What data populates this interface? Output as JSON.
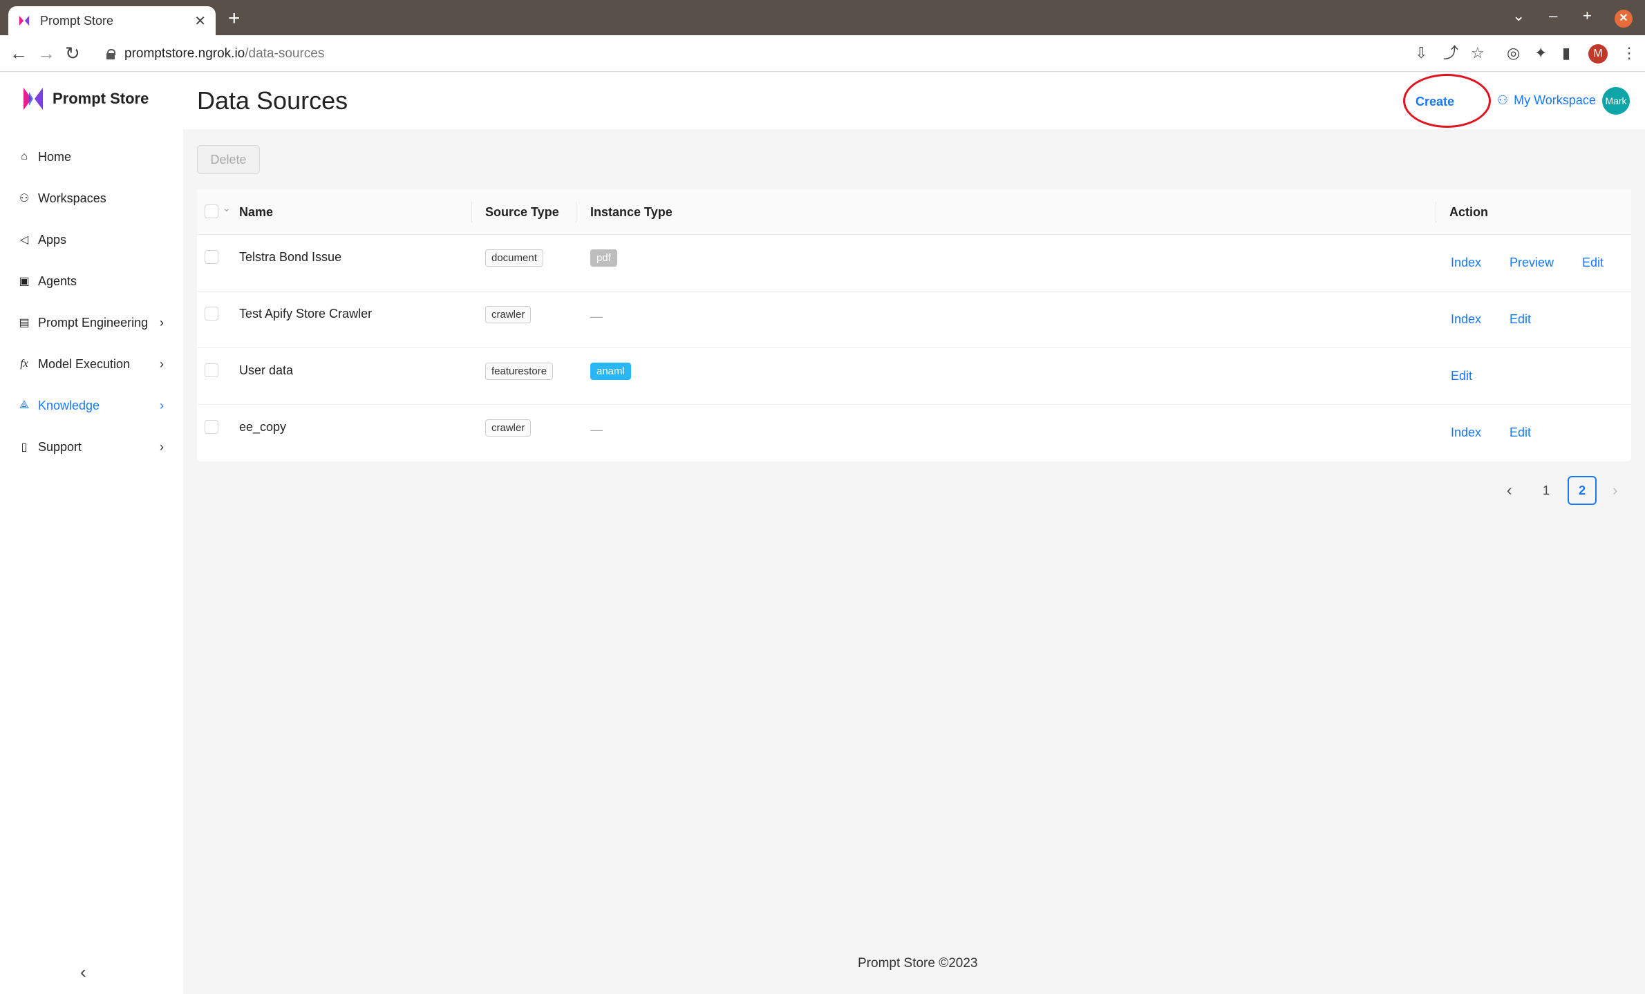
{
  "browser": {
    "tab_title": "Prompt Store",
    "url_host": "promptstore.ngrok.io",
    "url_path": "/data-sources",
    "profile_initial": "M"
  },
  "app": {
    "name": "Prompt Store",
    "page_title": "Data Sources",
    "create_label": "Create",
    "workspace_label": "My Workspace",
    "avatar_label": "Mark",
    "footer": "Prompt Store ©2023"
  },
  "sidebar": {
    "items": [
      {
        "label": "Home",
        "icon": "home-icon"
      },
      {
        "label": "Workspaces",
        "icon": "users-icon"
      },
      {
        "label": "Apps",
        "icon": "megaphone-icon"
      },
      {
        "label": "Agents",
        "icon": "robot-icon"
      },
      {
        "label": "Prompt Engineering",
        "icon": "terminal-icon"
      },
      {
        "label": "Model Execution",
        "icon": "function-icon"
      },
      {
        "label": "Knowledge",
        "icon": "nodes-icon"
      },
      {
        "label": "Support",
        "icon": "book-icon"
      }
    ]
  },
  "toolbar": {
    "delete_label": "Delete"
  },
  "table": {
    "columns": {
      "name": "Name",
      "source_type": "Source Type",
      "instance_type": "Instance Type",
      "action": "Action"
    },
    "rows": [
      {
        "name": "Telstra Bond Issue",
        "source_type": "document",
        "instance_type": "pdf",
        "actions": [
          "Index",
          "Preview",
          "Edit"
        ]
      },
      {
        "name": "Test Apify Store Crawler",
        "source_type": "crawler",
        "instance_type": "—",
        "actions": [
          "Index",
          "Edit"
        ]
      },
      {
        "name": "User data",
        "source_type": "featurestore",
        "instance_type": "anaml",
        "actions": [
          "Edit"
        ]
      },
      {
        "name": "ee_copy",
        "source_type": "crawler",
        "instance_type": "—",
        "actions": [
          "Index",
          "Edit"
        ]
      }
    ]
  },
  "pagination": {
    "pages": [
      "1",
      "2"
    ],
    "current": "2"
  },
  "colors": {
    "accent": "#1677ff",
    "highlight_ring": "#e0141e",
    "avatar": "#0ea5a9",
    "tag_anaml": "#29b6f6",
    "tag_pdf": "#bdbdbd"
  }
}
